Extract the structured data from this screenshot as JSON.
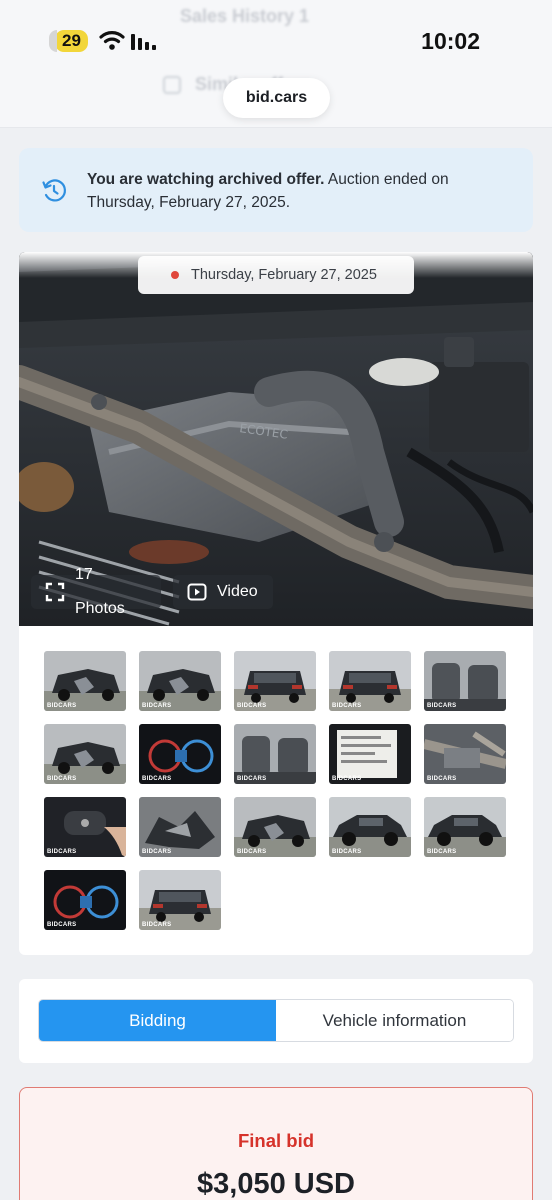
{
  "status_bar": {
    "battery": "29",
    "time": "10:02"
  },
  "background_header": {
    "ghost_title_1": "Sales History 1",
    "ghost_title_2": "Similar offers"
  },
  "browser": {
    "domain": "bid.cars"
  },
  "notice": {
    "bold_text": "You are watching archived offer.",
    "text": " Auction ended on Thursday, February 27, 2025."
  },
  "gallery": {
    "date": "Thursday, February 27, 2025",
    "photos_label": "17 Photos",
    "video_label": "Video",
    "watermark": "BIDCARS",
    "thumbnails": [
      {
        "name": "thumb-front-damage-side",
        "icon": "car-front-damage"
      },
      {
        "name": "thumb-front-damage",
        "icon": "car-front-damage"
      },
      {
        "name": "thumb-rear-left",
        "icon": "car-rear"
      },
      {
        "name": "thumb-rear-right",
        "icon": "car-rear"
      },
      {
        "name": "thumb-interior-front",
        "icon": "seats"
      },
      {
        "name": "thumb-front-wreck",
        "icon": "car-front-damage"
      },
      {
        "name": "thumb-instrument-cluster",
        "icon": "gauges"
      },
      {
        "name": "thumb-rear-seats",
        "icon": "seats"
      },
      {
        "name": "thumb-window-sticker",
        "icon": "label"
      },
      {
        "name": "thumb-engine-bay",
        "icon": "engine"
      },
      {
        "name": "thumb-key-fob",
        "icon": "key"
      },
      {
        "name": "thumb-debris",
        "icon": "debris"
      },
      {
        "name": "thumb-front-view",
        "icon": "car-front-damage"
      },
      {
        "name": "thumb-side-right",
        "icon": "car-side"
      },
      {
        "name": "thumb-side-left",
        "icon": "car-side"
      },
      {
        "name": "thumb-dashboard-display",
        "icon": "gauges"
      },
      {
        "name": "thumb-rear-outdoor",
        "icon": "car-rear"
      }
    ]
  },
  "tabs": [
    {
      "label": "Bidding",
      "active": true
    },
    {
      "label": "Vehicle information",
      "active": false
    }
  ],
  "final_bid": {
    "label": "Final bid",
    "value": "$3,050 USD"
  },
  "colors": {
    "accent": "#2595f0",
    "danger": "#d6332b",
    "notice_bg": "#e3eff9",
    "battery": "#f2d63a"
  }
}
